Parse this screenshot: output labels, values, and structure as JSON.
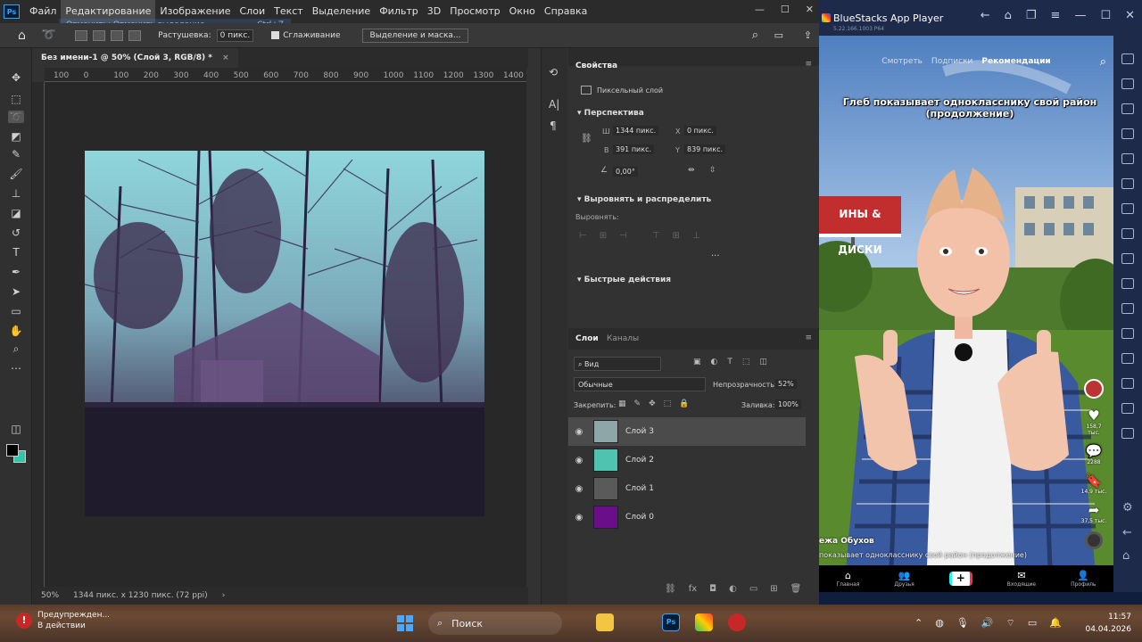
{
  "photoshop": {
    "logo": "Ps",
    "menu": [
      "Файл",
      "Редактирование",
      "Изображение",
      "Слои",
      "Текст",
      "Выделение",
      "Фильтр",
      "3D",
      "Просмотр",
      "Окно",
      "Справка"
    ],
    "active_menu_index": 1,
    "undo_tip": {
      "label": "Отменить: Отменить выделение",
      "shortcut": "Ctrl+Z"
    },
    "options": {
      "feather_label": "Растушевка:",
      "feather_value": "0 пикс.",
      "smoothing_label": "Сглаживание",
      "select_mask_button": "Выделение и маска..."
    },
    "document_tab": "Без имени-1 @ 50% (Слой 3, RGB/8) *",
    "ruler_ticks": [
      "100",
      "0",
      "100",
      "200",
      "300",
      "400",
      "500",
      "600",
      "700",
      "800",
      "900",
      "1000",
      "1100",
      "1200",
      "1300",
      "1400"
    ],
    "status": {
      "zoom": "50%",
      "doc_info": "1344 пикс. x 1230 пикс. (72 ppi)"
    },
    "properties": {
      "tab": "Свойства",
      "layer_kind": "Пиксельный слой",
      "perspective_title": "Перспектива",
      "w_label": "Ш",
      "w_value": "1344 пикс.",
      "x_label": "X",
      "x_value": "0 пикс.",
      "h_label": "В",
      "h_value": "391 пикс.",
      "y_label": "Y",
      "y_value": "839 пикс.",
      "angle_value": "0,00°",
      "align_title": "Выровнять и распределить",
      "align_label": "Выровнять:",
      "quick_actions_title": "Быстрые действия"
    },
    "layers": {
      "tabs": [
        "Слои",
        "Каналы"
      ],
      "filter_label": "Вид",
      "blend_mode": "Обычные",
      "opacity_label": "Непрозрачность:",
      "opacity_value": "52%",
      "lock_label": "Закрепить:",
      "fill_label": "Заливка:",
      "fill_value": "100%",
      "items": [
        {
          "name": "Слой 3",
          "selected": true,
          "thumb": "#8fa6a8"
        },
        {
          "name": "Слой 2",
          "selected": false,
          "thumb": "#4fc2b0"
        },
        {
          "name": "Слой 1",
          "selected": false,
          "thumb": "#5a5a5a"
        },
        {
          "name": "Слой 0",
          "selected": false,
          "thumb": "#6a0e8a"
        }
      ]
    }
  },
  "bluestacks": {
    "title": "BlueStacks App Player",
    "version": "5.22.166.1003  P64",
    "top_tabs": [
      "Смотреть",
      "Подписки",
      "Рекомендации"
    ],
    "active_top_tab": 2,
    "caption": "Глеб показывает однокласснику свой район (продолжение)",
    "sign_text": "ИНЫ & ДИСКИ",
    "author": "ежа Обухов",
    "description": "показывает однокласснику свой район (продолжение)",
    "actions": [
      {
        "icon": "heart-icon",
        "count": "158,7 тыс."
      },
      {
        "icon": "comment-icon",
        "count": "2288"
      },
      {
        "icon": "bookmark-icon",
        "count": "14,9 тыс."
      },
      {
        "icon": "share-icon",
        "count": "37,5 тыс."
      }
    ],
    "nav": [
      "Главная",
      "Друзья",
      "",
      "Входящие",
      "Профиль"
    ]
  },
  "taskbar": {
    "notification_title": "Предупрежден...",
    "notification_sub": "В действии",
    "search_placeholder": "Поиск",
    "time": "11:57",
    "date": "04.04.2026"
  },
  "colors": {
    "ps_bg": "#323232",
    "accent": "#31a8ff",
    "bluestacks_bar": "#1e2a4a"
  }
}
